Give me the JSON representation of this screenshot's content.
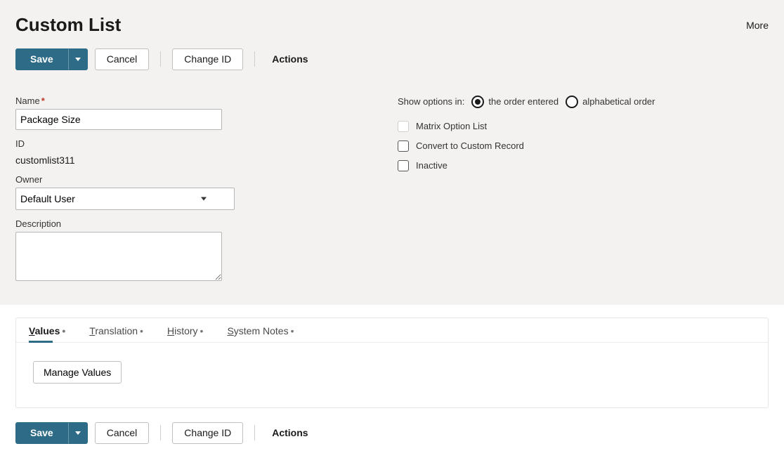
{
  "header": {
    "title": "Custom List",
    "more": "More"
  },
  "toolbar": {
    "save": "Save",
    "cancel": "Cancel",
    "change_id": "Change ID",
    "actions": "Actions"
  },
  "form": {
    "name_label": "Name",
    "name_value": "Package Size",
    "id_label": "ID",
    "id_value": "customlist311",
    "owner_label": "Owner",
    "owner_value": "Default User",
    "description_label": "Description",
    "description_value": ""
  },
  "options": {
    "show_options_label": "Show options in:",
    "order_entered_label": "the order entered",
    "alphabetical_label": "alphabetical order",
    "order_selected": "entered",
    "matrix_label": "Matrix Option List",
    "matrix_checked": false,
    "convert_label": "Convert to Custom Record",
    "convert_checked": false,
    "inactive_label": "Inactive",
    "inactive_checked": false
  },
  "tabs": {
    "values": "Values",
    "translation": "Translation",
    "history": "History",
    "system_notes": "System Notes",
    "manage_values": "Manage Values"
  }
}
